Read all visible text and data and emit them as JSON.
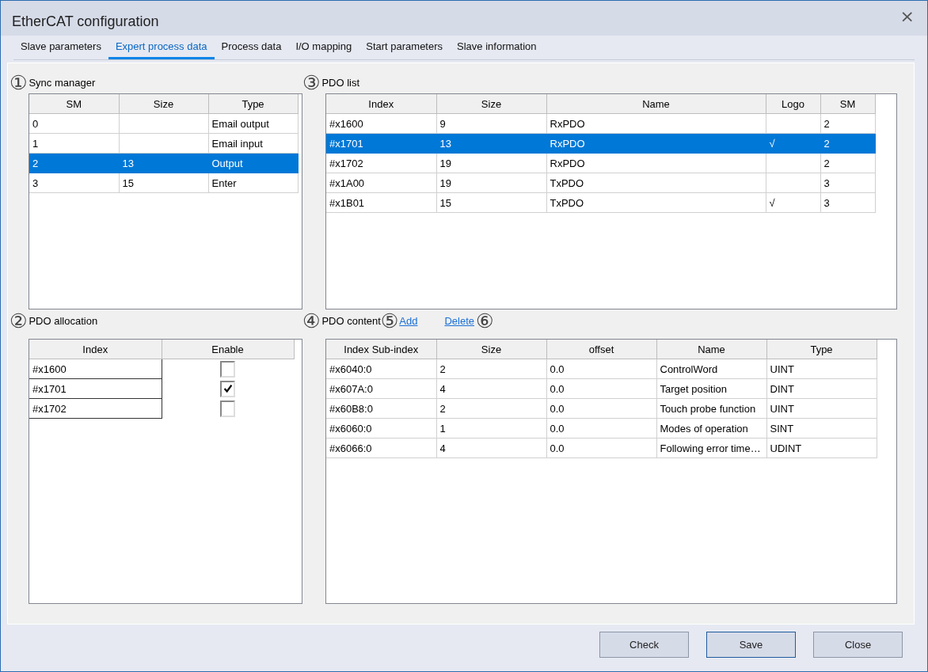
{
  "window": {
    "title": "EtherCAT configuration",
    "close": "×"
  },
  "tabs": [
    {
      "label": "Slave parameters",
      "selected": false
    },
    {
      "label": "Expert process data",
      "selected": true
    },
    {
      "label": "Process data",
      "selected": false
    },
    {
      "label": "I/O mapping",
      "selected": false
    },
    {
      "label": "Start parameters",
      "selected": false
    },
    {
      "label": "Slave information",
      "selected": false
    }
  ],
  "sync_manager": {
    "marker": "①",
    "label": "Sync manager",
    "columns": [
      "SM",
      "Size",
      "Type"
    ],
    "rows": [
      {
        "cells": [
          "0",
          null,
          "Email output"
        ],
        "selected": false
      },
      {
        "cells": [
          "1",
          null,
          "Email input"
        ],
        "selected": false
      },
      {
        "cells": [
          "2",
          "13",
          "Output"
        ],
        "selected": true
      },
      {
        "cells": [
          "3",
          "15",
          "Enter"
        ],
        "selected": false
      }
    ]
  },
  "pdo_list": {
    "marker": "③",
    "label": "PDO list",
    "columns": [
      "Index",
      "Size",
      "Name",
      "Logo",
      "SM"
    ],
    "rows": [
      {
        "cells": [
          "#x1600",
          "9",
          "RxPDO",
          null,
          "2"
        ],
        "selected": false
      },
      {
        "cells": [
          "#x1701",
          "13",
          "RxPDO",
          "√",
          "2"
        ],
        "selected": true
      },
      {
        "cells": [
          "#x1702",
          "19",
          "RxPDO",
          null,
          "2"
        ],
        "selected": false
      },
      {
        "cells": [
          "#x1A00",
          "19",
          "TxPDO",
          null,
          "3"
        ],
        "selected": false
      },
      {
        "cells": [
          "#x1B01",
          "15",
          "TxPDO",
          "√",
          "3"
        ],
        "selected": false
      }
    ]
  },
  "pdo_allocation": {
    "marker": "②",
    "label": "PDO allocation",
    "columns": [
      "Index",
      "Enable"
    ],
    "rows": [
      {
        "index": "#x1600",
        "checked": false
      },
      {
        "index": "#x1701",
        "checked": true
      },
      {
        "index": "#x1702",
        "checked": false
      }
    ]
  },
  "pdo_content": {
    "marker": "④",
    "label": "PDO content",
    "add": {
      "marker": "⑤",
      "label": "Add"
    },
    "delete": {
      "marker": "⑥",
      "label": "Delete"
    },
    "columns": [
      "Index Sub-index",
      "Size",
      "offset",
      "Name",
      "Type"
    ],
    "rows": [
      {
        "cells": [
          "#x6040:0",
          "2",
          "0.0",
          "ControlWord",
          "UINT"
        ],
        "selected": false
      },
      {
        "cells": [
          "#x607A:0",
          "4",
          "0.0",
          "Target position",
          "DINT"
        ],
        "selected": false
      },
      {
        "cells": [
          "#x60B8:0",
          "2",
          "0.0",
          "Touch probe function",
          "UINT"
        ],
        "selected": false
      },
      {
        "cells": [
          "#x6060:0",
          "1",
          "0.0",
          "Modes of operation",
          "SINT"
        ],
        "selected": false
      },
      {
        "cells": [
          "#x6066:0",
          "4",
          "0.0",
          "Following error time…",
          "UDINT"
        ],
        "selected": false
      }
    ]
  },
  "buttons": [
    {
      "label": "Check",
      "focused": false
    },
    {
      "label": "Save",
      "focused": true
    },
    {
      "label": "Close",
      "focused": false
    }
  ]
}
